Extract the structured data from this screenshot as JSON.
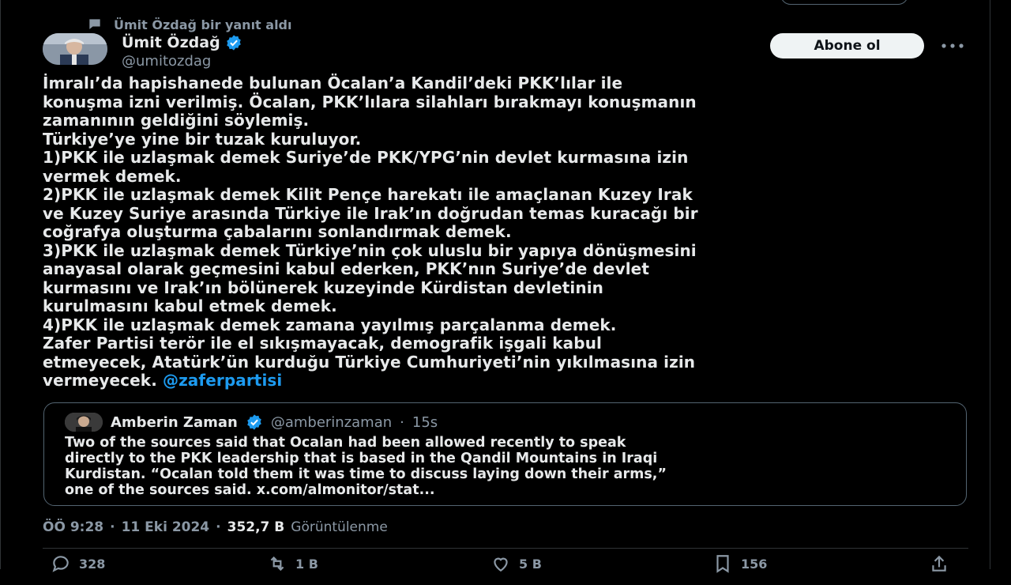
{
  "reply_context": {
    "text": "Ümit Özdağ bir yanıt aldı",
    "icon": "speech-bubble-icon"
  },
  "author": {
    "name": "Ümit Özdağ",
    "handle": "@umitozdag",
    "verified": true
  },
  "subscribe_label": "Abone ol",
  "tweet": {
    "lines": [
      "İmralı’da hapishanede bulunan Öcalan’a Kandil’deki PKK’lılar ile",
      "konuşma izni verilmiş. Öcalan, PKK’lılara silahları bırakmayı konuşmanın",
      "zamanının geldiğini söylemiş.",
      "Türkiye’ye yine bir tuzak kuruluyor.",
      "1)PKK ile uzlaşmak demek Suriye’de PKK/YPG’nin devlet kurmasına izin",
      "vermek demek.",
      "2)PKK ile uzlaşmak demek Kilit Pençe harekatı ile amaçlanan Kuzey Irak",
      "ve Kuzey Suriye arasında Türkiye ile Irak’ın doğrudan temas kuracağı bir",
      "coğrafya oluşturma çabalarını sonlandırmak demek.",
      "3)PKK ile uzlaşmak demek Türkiye’nin çok uluslu bir yapıya dönüşmesini",
      "anayasal olarak geçmesini kabul ederken, PKK’nın Suriye’de devlet",
      "kurmasını ve Irak’ın bölünerek kuzeyinde Kürdistan devletinin",
      "kurulmasını kabul etmek demek.",
      "4)PKK ile uzlaşmak demek zamana yayılmış parçalanma demek.",
      "Zafer Partisi terör ile el sıkışmayacak, demografik işgali kabul",
      "etmeyecek, Atatürk’ün kurduğu Türkiye Cumhuriyeti’nin yıkılmasına izin"
    ],
    "last_line_text": "vermeyecek.",
    "mention": "@zaferpartisi"
  },
  "quote": {
    "name": "Amberin Zaman",
    "handle": "@amberinzaman",
    "separator": "·",
    "time": "15s",
    "lines": [
      "Two of the sources said that Ocalan had been allowed recently to speak",
      "directly to the PKK leadership that is based in the Qandil Mountains in Iraqi",
      "Kurdistan. “Ocalan told them it was time to discuss laying down their arms,”",
      "one of the sources said. x.com/almonitor/stat..."
    ]
  },
  "meta": {
    "time": "ÖÖ 9:28",
    "sep1": "·",
    "date": "11 Eki 2024",
    "sep2": "·",
    "views_count": "352,7 B",
    "views_label": "Görüntülenme"
  },
  "actions": {
    "replies": "328",
    "reposts": "1 B",
    "likes": "5 B",
    "bookmarks": "156"
  },
  "colors": {
    "accent": "#1d9bf0",
    "background": "#000000",
    "text": "#e7e9ea",
    "muted": "#8b98a5",
    "border": "#536471"
  }
}
